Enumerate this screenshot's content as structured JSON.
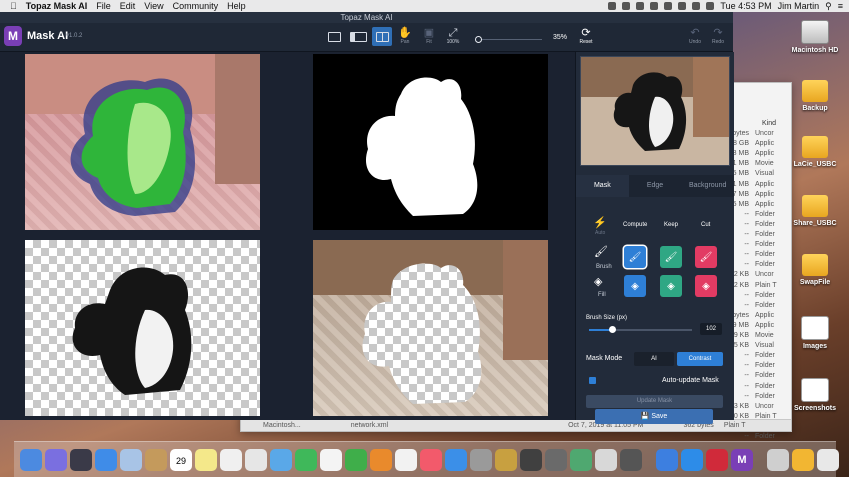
{
  "menubar": {
    "apple": "",
    "app_name": "Topaz Mask AI",
    "items": [
      "File",
      "Edit",
      "View",
      "Community",
      "Help"
    ],
    "clock": "Tue 4:53 PM",
    "user": "Jim Martin"
  },
  "window": {
    "title": "Topaz Mask AI"
  },
  "toolbar": {
    "app_name": "Mask AI",
    "version": "v1.0.2",
    "view_modes": [
      "single-view",
      "split-view",
      "quad-view"
    ],
    "active_view": "quad-view",
    "pan_label": "Pan",
    "fit_label": "Fit",
    "zoom100_label": "100%",
    "zoom_value": "35%",
    "zoom_level": 0.35,
    "reset_label": "Reset",
    "undo_label": "Undo",
    "redo_label": "Redo"
  },
  "panel": {
    "tabs": [
      "Mask",
      "Edge",
      "Background"
    ],
    "active_tab": "Mask",
    "auto_label": "Auto",
    "columns": [
      "Compute",
      "Keep",
      "Cut"
    ],
    "tool_labels": {
      "brush": "Brush",
      "fill": "Fill"
    },
    "brush_size_label": "Brush Size (px)",
    "brush_size_value": "102",
    "brush_size_fraction": 0.22,
    "mask_mode_label": "Mask Mode",
    "mask_mode_options": [
      "AI",
      "Contrast"
    ],
    "mask_mode_selected": "Contrast",
    "auto_update_label": "Auto-update Mask",
    "auto_update_checked": true,
    "update_mask_label": "Update Mask",
    "save_label": "Save"
  },
  "finder": {
    "kind_header": "Kind",
    "rows": [
      [
        "bytes",
        "Uncor"
      ],
      [
        "58 GB",
        "Applic"
      ],
      [
        "8 MB",
        "Applic"
      ],
      [
        "1 MB",
        "Movie"
      ],
      [
        "5 MB",
        "Visual"
      ],
      [
        "1 MB",
        "Applic"
      ],
      [
        "7 MB",
        "Applic"
      ],
      [
        "5 MB",
        "Applic"
      ],
      [
        "--",
        "Folder"
      ],
      [
        "--",
        "Folder"
      ],
      [
        "--",
        "Folder"
      ],
      [
        "--",
        "Folder"
      ],
      [
        "--",
        "Folder"
      ],
      [
        "--",
        "Folder"
      ],
      [
        "32 KB",
        "Uncor"
      ],
      [
        "12 KB",
        "Plain T"
      ],
      [
        "--",
        "Folder"
      ],
      [
        "--",
        "Folder"
      ],
      [
        "bytes",
        "Applic"
      ],
      [
        "9 MB",
        "Applic"
      ],
      [
        "69 KB",
        "Movie"
      ],
      [
        "15 KB",
        "Visual"
      ],
      [
        "--",
        "Folder"
      ],
      [
        "--",
        "Folder"
      ],
      [
        "--",
        "Folder"
      ],
      [
        "--",
        "Folder"
      ],
      [
        "--",
        "Folder"
      ],
      [
        "3 KB",
        "Uncor"
      ],
      [
        "20 KB",
        "Plain T"
      ],
      [
        "--",
        "Folder"
      ],
      [
        "--",
        "Folder"
      ]
    ],
    "path_left": "Macintosh...",
    "path_file": "network.xml",
    "status_date": "Oct 7, 2019 at 11:05 PM",
    "status_size": "362 bytes",
    "status_kind": "Plain T"
  },
  "desktop_icons": [
    "Macintosh HD",
    "Backup",
    "LaCie_USBC",
    "Share_USBC",
    "SwapFile",
    "Images",
    "Screenshots"
  ],
  "dock": {
    "calendar_date": "29"
  }
}
